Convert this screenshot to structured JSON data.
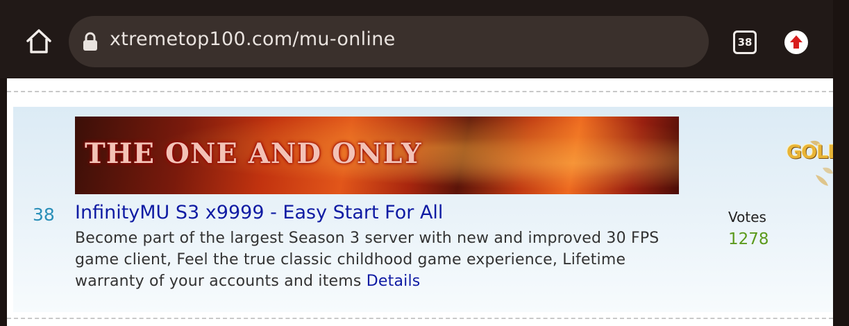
{
  "browser": {
    "url": "xtremetop100.com/mu-online",
    "tab_count": "38",
    "icons": {
      "home": "home-icon",
      "lock": "lock-icon",
      "tabs": "tabs-icon",
      "upload": "upload-arrow-icon"
    }
  },
  "listing": {
    "rank": "38",
    "banner_text": "THE ONE AND ONLY",
    "title": "InfinityMU S3 x9999 - Easy Start For All",
    "description": "Become part of the largest Season 3 server with new and improved 30 FPS game client, Feel the true classic childhood game experience, Lifetime warranty of your accounts and items",
    "details_label": "Details",
    "votes_label": "Votes",
    "votes_count": "1278",
    "badge_text": "GOLD"
  },
  "colors": {
    "toolbar_bg": "#211917",
    "link_blue": "#0f1ba3",
    "rank_teal": "#2a8fb8",
    "votes_green": "#5c9a1c",
    "upload_red": "#d81e1e"
  }
}
